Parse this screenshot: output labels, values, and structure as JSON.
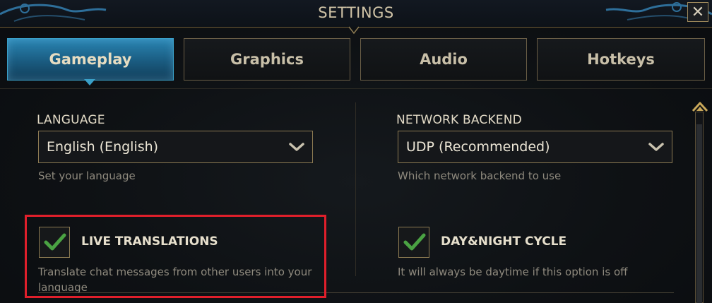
{
  "window": {
    "title": "SETTINGS",
    "close_label": "✕"
  },
  "tabs": [
    {
      "label": "Gameplay",
      "active": true
    },
    {
      "label": "Graphics",
      "active": false
    },
    {
      "label": "Audio",
      "active": false
    },
    {
      "label": "Hotkeys",
      "active": false
    }
  ],
  "language": {
    "label": "LANGUAGE",
    "value": "English (English)",
    "hint": "Set your language"
  },
  "network": {
    "label": "NETWORK BACKEND",
    "value": "UDP (Recommended)",
    "hint": "Which network backend to use"
  },
  "live_translations": {
    "label": "LIVE TRANSLATIONS",
    "checked": true,
    "hint_line1": "Translate chat messages from other users into your",
    "hint_line2": "language"
  },
  "day_night": {
    "label": "DAY&NIGHT CYCLE",
    "checked": true,
    "hint": "It will always be daytime if this option is off"
  },
  "colors": {
    "accent_tab": "#2a86b4",
    "gold_border": "#8c7a52",
    "check_green": "#4aa243",
    "highlight_red": "#e01f2b"
  },
  "icons": {
    "close": "close-icon",
    "dropdown": "chevron-down-icon",
    "check": "checkmark-icon",
    "scroll_up": "scroll-up-icon"
  }
}
